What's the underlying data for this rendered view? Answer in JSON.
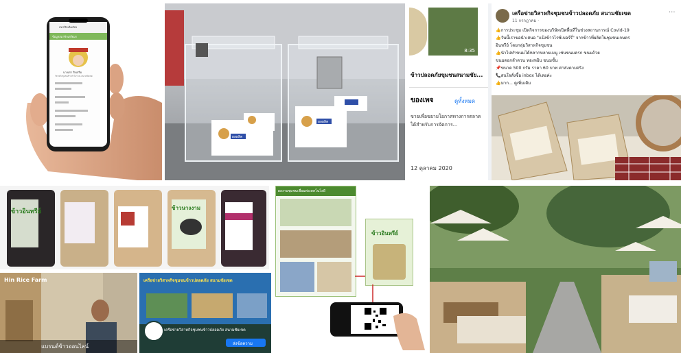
{
  "phone": {
    "header": "สมาชิกเดิมสังข",
    "section": "ข้อมูลสมาชิกเตรียมร",
    "name": "นางเสา สิงเสริม",
    "subtitle": "วิสาหกิจชุมชนข้าวกำโบราณ สนามชัยเขต"
  },
  "boxes": {
    "label1": "ผลผลิต",
    "label2": "ผลผลิต"
  },
  "fb_post": {
    "page_name": "เครือข่ายวิสาหกิจชุมชนข้าวปลอดภัย สนามชัยเขต",
    "date": "11 กรกฎาคม ·",
    "lines": [
      "👍การประชุม เปิดกิจการของบริษัทเปิดพื้นที่ในช่วงสถานการณ์ Covid-19",
      "👍วันนี้เราขอนำเสนอ \"แป้งข้าวไรซ์เบอร์รี่\" จากข้าวที่ผลิตในชุมชนเกษตร",
      "อินทรีย์ โดยกลุ่มวิสาหกิจชุมชน",
      "👍นำไปทำขนมได้หลากหลายเมนู เช่นขนมครก ขนมถ้วย",
      "ขนมดอกลำดวน ทองหยิบ ขนมชั้น",
      "📌ขนาด 500 กรัม ราคา 60 บาท ค่าส่งตามจริง",
      "📞สนใจสั่งซื้อ inbox ได้เลยค่ะ",
      "👍มาก... ดูเพิ่มเติม"
    ],
    "side_title": "ข้าวปลอดภัยขุมชนสนามชัย...",
    "side_heading": "ของเพจ",
    "see_all": "ดูทั้งหมด",
    "side_text": "ขายเพื่อขยายโอกาสทางการตลาด",
    "side_text2": "ได้สำหรับการจัดการ...",
    "side_date": "12 ตุลาคม 2020",
    "video_time": "8:35"
  },
  "rice": {
    "pack_label": "ข้าวอินทรีย์",
    "pack_label2": "ข้าวนางงาม"
  },
  "info": {
    "banner": "ผลงานชุมชนเชื่อมต่อเทคโนโลยี",
    "pack_title": "ข้าวอินทรีย์"
  },
  "video": {
    "sign": "Hin Rice Farm",
    "caption": "แบรนด์ข้าวออนไลน์"
  },
  "group": {
    "banner": "เครือข่ายวิสาหกิจชุมชนข้าวปลอดภัย สนามชัยเขต",
    "name": "เครือข่ายวิสาหกิจชุมชนข้าวปลอดภัย สนามชัยเขต",
    "button": "ส่งข้อความ"
  },
  "colors": {
    "fb_blue": "#1877f2",
    "rice_green": "#4c8a2f",
    "banner_blue": "#2a6fb0"
  }
}
